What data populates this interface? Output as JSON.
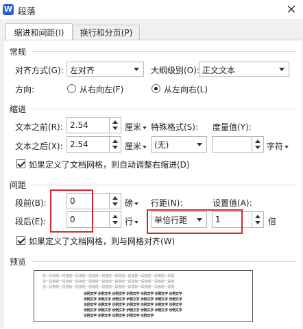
{
  "window": {
    "title": "段落",
    "app_icon_letter": "W",
    "close_glyph": "×"
  },
  "tabs": [
    {
      "label": "缩进和间距(I)",
      "active": true
    },
    {
      "label": "换行和分页(P)",
      "active": false
    }
  ],
  "general": {
    "section_label": "常规",
    "alignment_label": "对齐方式(G):",
    "alignment_value": "左对齐",
    "outline_label": "大纲级别(O):",
    "outline_value": "正文文本",
    "direction_label": "方向:",
    "rtl_label": "从右向左(F)",
    "ltr_label": "从左向右(L)",
    "ltr_selected": true
  },
  "indent": {
    "section_label": "缩进",
    "before_label": "文本之前(R):",
    "before_value": "2.54",
    "before_unit": "厘米",
    "after_label": "文本之后(X):",
    "after_value": "2.54",
    "after_unit": "厘米",
    "special_label": "特殊格式(S):",
    "special_value": "(无)",
    "measure_label": "度量值(Y):",
    "measure_value": "",
    "measure_unit": "字符",
    "auto_adjust_label": "如果定义了文档网格，则自动调整右缩进(D)",
    "auto_adjust_checked": true
  },
  "spacing": {
    "section_label": "间距",
    "before_label": "段前(B):",
    "before_value": "0",
    "before_unit": "磅",
    "after_label": "段后(E):",
    "after_value": "0",
    "after_unit": "行",
    "line_label": "行距(N):",
    "line_value": "单倍行距",
    "setting_label": "设置值(A):",
    "setting_value": "1",
    "setting_unit": "倍",
    "snap_label": "如果定义了文档网格，则与网格对齐(W)",
    "snap_checked": true
  },
  "preview": {
    "section_label": "预览",
    "light_line": "前一段落前一段落前一段落前一段落前一段落前一段落前一段落前一段落前一段落前一段落",
    "dark_line": "示例文字 示例文字 示例文字 示例文字 示例文字 示例文字 示例文字",
    "dark_line_short": "示例文字 示例文字 示例文字 示例文字 示例文字"
  }
}
